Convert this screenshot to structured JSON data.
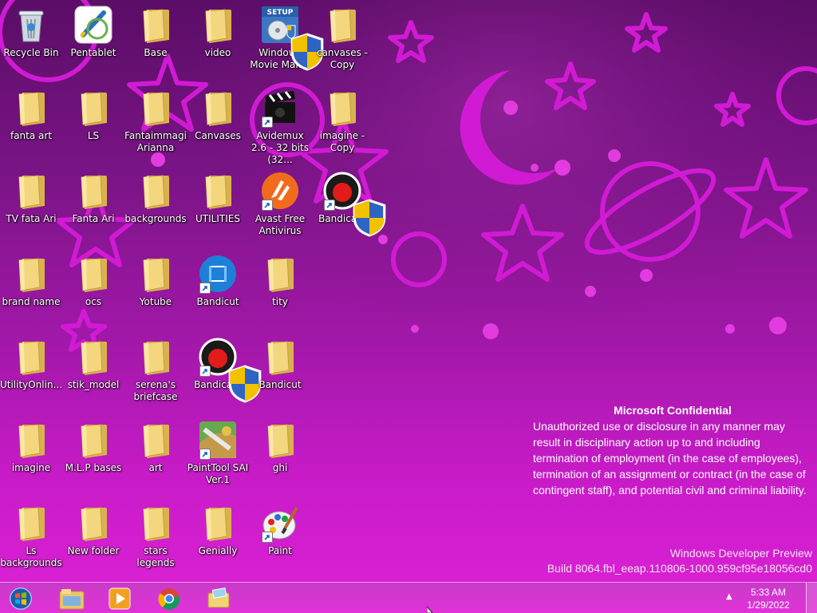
{
  "desktop": {
    "icons": [
      {
        "label": "Recycle Bin",
        "kind": "recycle-bin"
      },
      {
        "label": "Pentablet",
        "kind": "pentablet"
      },
      {
        "label": "Base",
        "kind": "folder"
      },
      {
        "label": "video",
        "kind": "folder"
      },
      {
        "label": "Windows Movie Mak...",
        "kind": "setup"
      },
      {
        "label": "canvases - Copy",
        "kind": "folder"
      },
      {
        "label": "fanta art",
        "kind": "folder"
      },
      {
        "label": "LS",
        "kind": "folder"
      },
      {
        "label": "Fantaimmagi Arianna",
        "kind": "folder"
      },
      {
        "label": "Canvases",
        "kind": "folder"
      },
      {
        "label": "Avidemux 2.6 - 32 bits (32...",
        "kind": "clapper"
      },
      {
        "label": "imagine - Copy",
        "kind": "folder"
      },
      {
        "label": "TV fata Ari",
        "kind": "folder"
      },
      {
        "label": "Fanta Ari",
        "kind": "folder"
      },
      {
        "label": "backgrounds",
        "kind": "folder"
      },
      {
        "label": "UTILITIES",
        "kind": "folder"
      },
      {
        "label": "Avast Free Antivirus",
        "kind": "avast"
      },
      {
        "label": "Bandicam",
        "kind": "bandicam"
      },
      {
        "label": "brand name",
        "kind": "folder"
      },
      {
        "label": "ocs",
        "kind": "folder"
      },
      {
        "label": "Yotube",
        "kind": "folder"
      },
      {
        "label": "Bandicut",
        "kind": "bandicut"
      },
      {
        "label": "tity",
        "kind": "folder"
      },
      {
        "label": "UtilityOnlin...",
        "kind": "folder"
      },
      {
        "label": "stik_model",
        "kind": "folder"
      },
      {
        "label": "serena's briefcase",
        "kind": "folder"
      },
      {
        "label": "Bandicam",
        "kind": "bandicam"
      },
      {
        "label": "Bandicut",
        "kind": "folder"
      },
      {
        "label": "imagine",
        "kind": "folder"
      },
      {
        "label": "M.L.P bases",
        "kind": "folder"
      },
      {
        "label": "art",
        "kind": "folder"
      },
      {
        "label": "PaintTool SAI Ver.1",
        "kind": "sai"
      },
      {
        "label": "ghi",
        "kind": "folder"
      },
      {
        "label": "Ls backgrounds",
        "kind": "folder"
      },
      {
        "label": "New folder",
        "kind": "folder"
      },
      {
        "label": "stars legends",
        "kind": "folder"
      },
      {
        "label": "Genially",
        "kind": "folder"
      },
      {
        "label": "Paint",
        "kind": "paint"
      }
    ]
  },
  "watermark": {
    "title": "Microsoft Confidential",
    "body": "Unauthorized use or disclosure in any manner may result in disciplinary action up to and including termination of employment (in the case of employees), termination of an assignment or contract (in the case of contingent staff), and potential civil and criminal liability.",
    "edition": "Windows Developer Preview",
    "build": "Build 8064.fbl_eeap.110806-1000.959cf95e18056cd0"
  },
  "taskbar": {
    "clock_time": "5:33 AM",
    "clock_date": "1/29/2022",
    "tray_arrow": "▲"
  },
  "colors": {
    "folder": "#f4d67e",
    "folder_dark": "#d8b24e",
    "accent": "#c81bc8"
  }
}
